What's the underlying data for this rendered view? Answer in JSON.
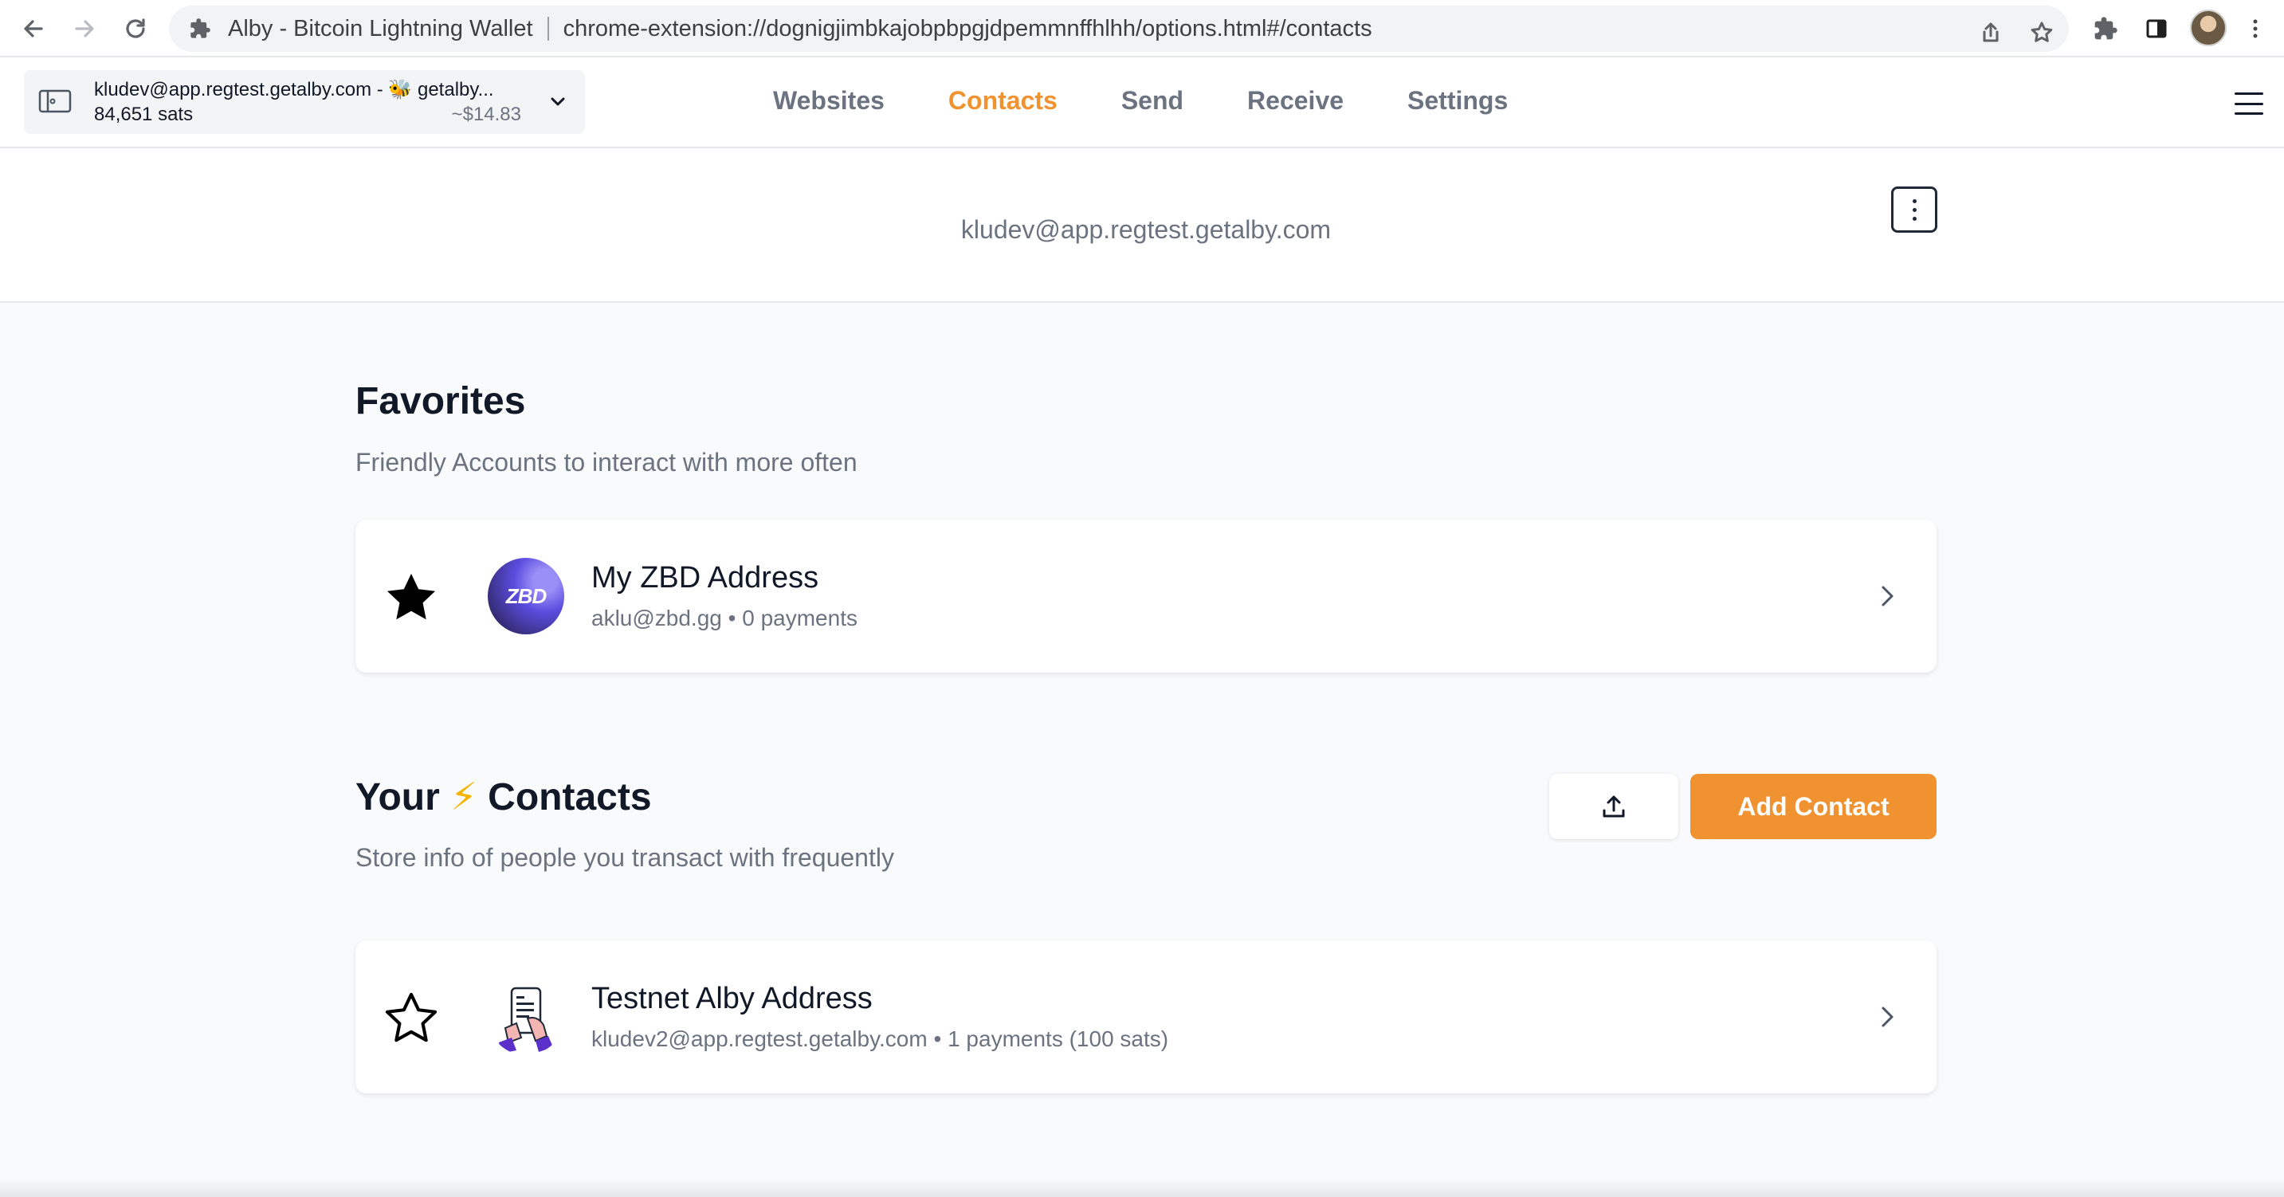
{
  "browser": {
    "tab_title": "Alby - Bitcoin Lightning Wallet",
    "url": "chrome-extension://dognigjimbkajobpbpgjdpemmnffhlhh/options.html#/contacts",
    "icons": [
      "back-icon",
      "forward-icon",
      "reload-icon",
      "extension-icon",
      "share-icon",
      "bookmark-star-icon",
      "extensions-puzzle-icon",
      "side-panel-icon",
      "profile-avatar",
      "more-vert-icon"
    ]
  },
  "account": {
    "name": "kludev@app.regtest.getalby.com - 🐝 getalby...",
    "balance": "84,651 sats",
    "fiat": "~$14.83"
  },
  "nav": {
    "tabs": [
      {
        "label": "Websites",
        "active": false
      },
      {
        "label": "Contacts",
        "active": true
      },
      {
        "label": "Send",
        "active": false
      },
      {
        "label": "Receive",
        "active": false
      },
      {
        "label": "Settings",
        "active": false
      }
    ]
  },
  "publisher": {
    "title": "kludev@app.regtest.getalby.com"
  },
  "favorites": {
    "title": "Favorites",
    "subtitle": "Friendly Accounts to interact with more often",
    "items": [
      {
        "name": "My ZBD Address",
        "address": "aklu@zbd.gg",
        "separator": "•",
        "payments": "0 payments",
        "avatar_text": "ZBD",
        "favorite": true
      }
    ]
  },
  "contacts": {
    "title_before": "Your",
    "title_emoji": "⚡",
    "title_after": "Contacts",
    "subtitle": "Store info of people you transact with frequently",
    "add_label": "Add Contact",
    "items": [
      {
        "name": "Testnet Alby Address",
        "address": "kludev2@app.regtest.getalby.com",
        "separator": "•",
        "payments": "1 payments (100 sats)",
        "favorite": false
      }
    ]
  },
  "colors": {
    "accent": "#f0922f",
    "muted": "#6b7280",
    "background": "#f9fafb"
  }
}
